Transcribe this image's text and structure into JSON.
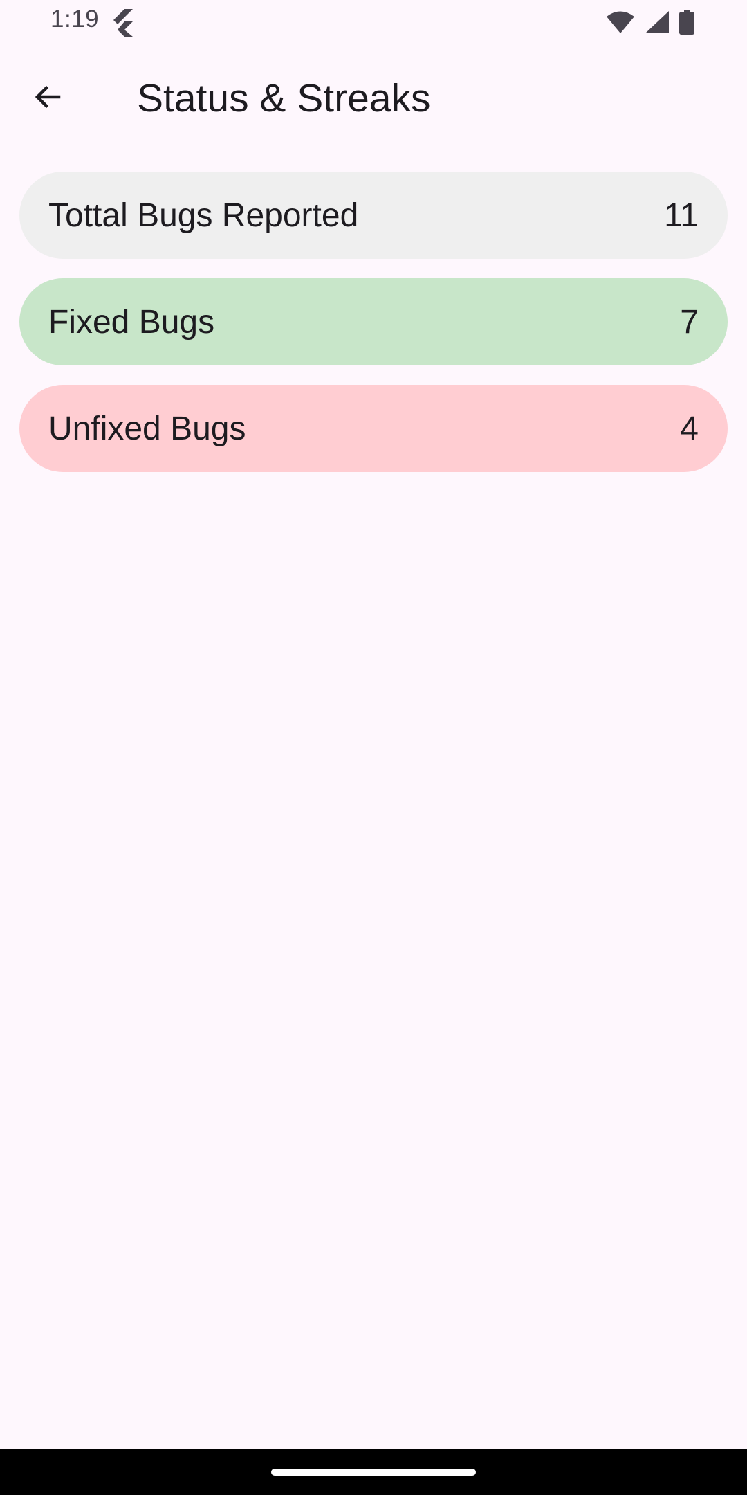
{
  "status_bar": {
    "time": "1:19",
    "icons": [
      "flutter-icon",
      "wifi-icon",
      "signal-icon",
      "battery-icon"
    ]
  },
  "app_bar": {
    "back_icon": "arrow-back-icon",
    "title": "Status & Streaks"
  },
  "stats": [
    {
      "label": "Tottal Bugs Reported",
      "value": "11",
      "color": "#efefef"
    },
    {
      "label": "Fixed Bugs",
      "value": "7",
      "color": "#c8e6c9"
    },
    {
      "label": "Unfixed Bugs",
      "value": "4",
      "color": "#ffcdd2"
    }
  ],
  "theme": {
    "background": "#fef7fd",
    "text": "#1d1b20"
  }
}
